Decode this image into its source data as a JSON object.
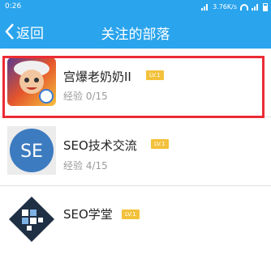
{
  "status_bar": {
    "time": "0:26",
    "speed": "3.76K/s"
  },
  "nav": {
    "back_label": "返回",
    "title": "关注的部落"
  },
  "groups": [
    {
      "name": "宫爆老奶奶II",
      "level": "LV.1",
      "exp": "经验 0/15",
      "logo": "game-character-logo"
    },
    {
      "name": "SEO技术交流",
      "level": "LV.1",
      "exp": "经验 4/15",
      "logo": "SE",
      "logo_color": "#3c7bc0"
    },
    {
      "name": "SEO学堂",
      "level": "LV.1",
      "exp": "",
      "logo": "seo-academy-logo"
    }
  ],
  "colors": {
    "header": "#2aa4ec",
    "highlight": "#ec2b35",
    "level_badge": "#f3c13b"
  }
}
